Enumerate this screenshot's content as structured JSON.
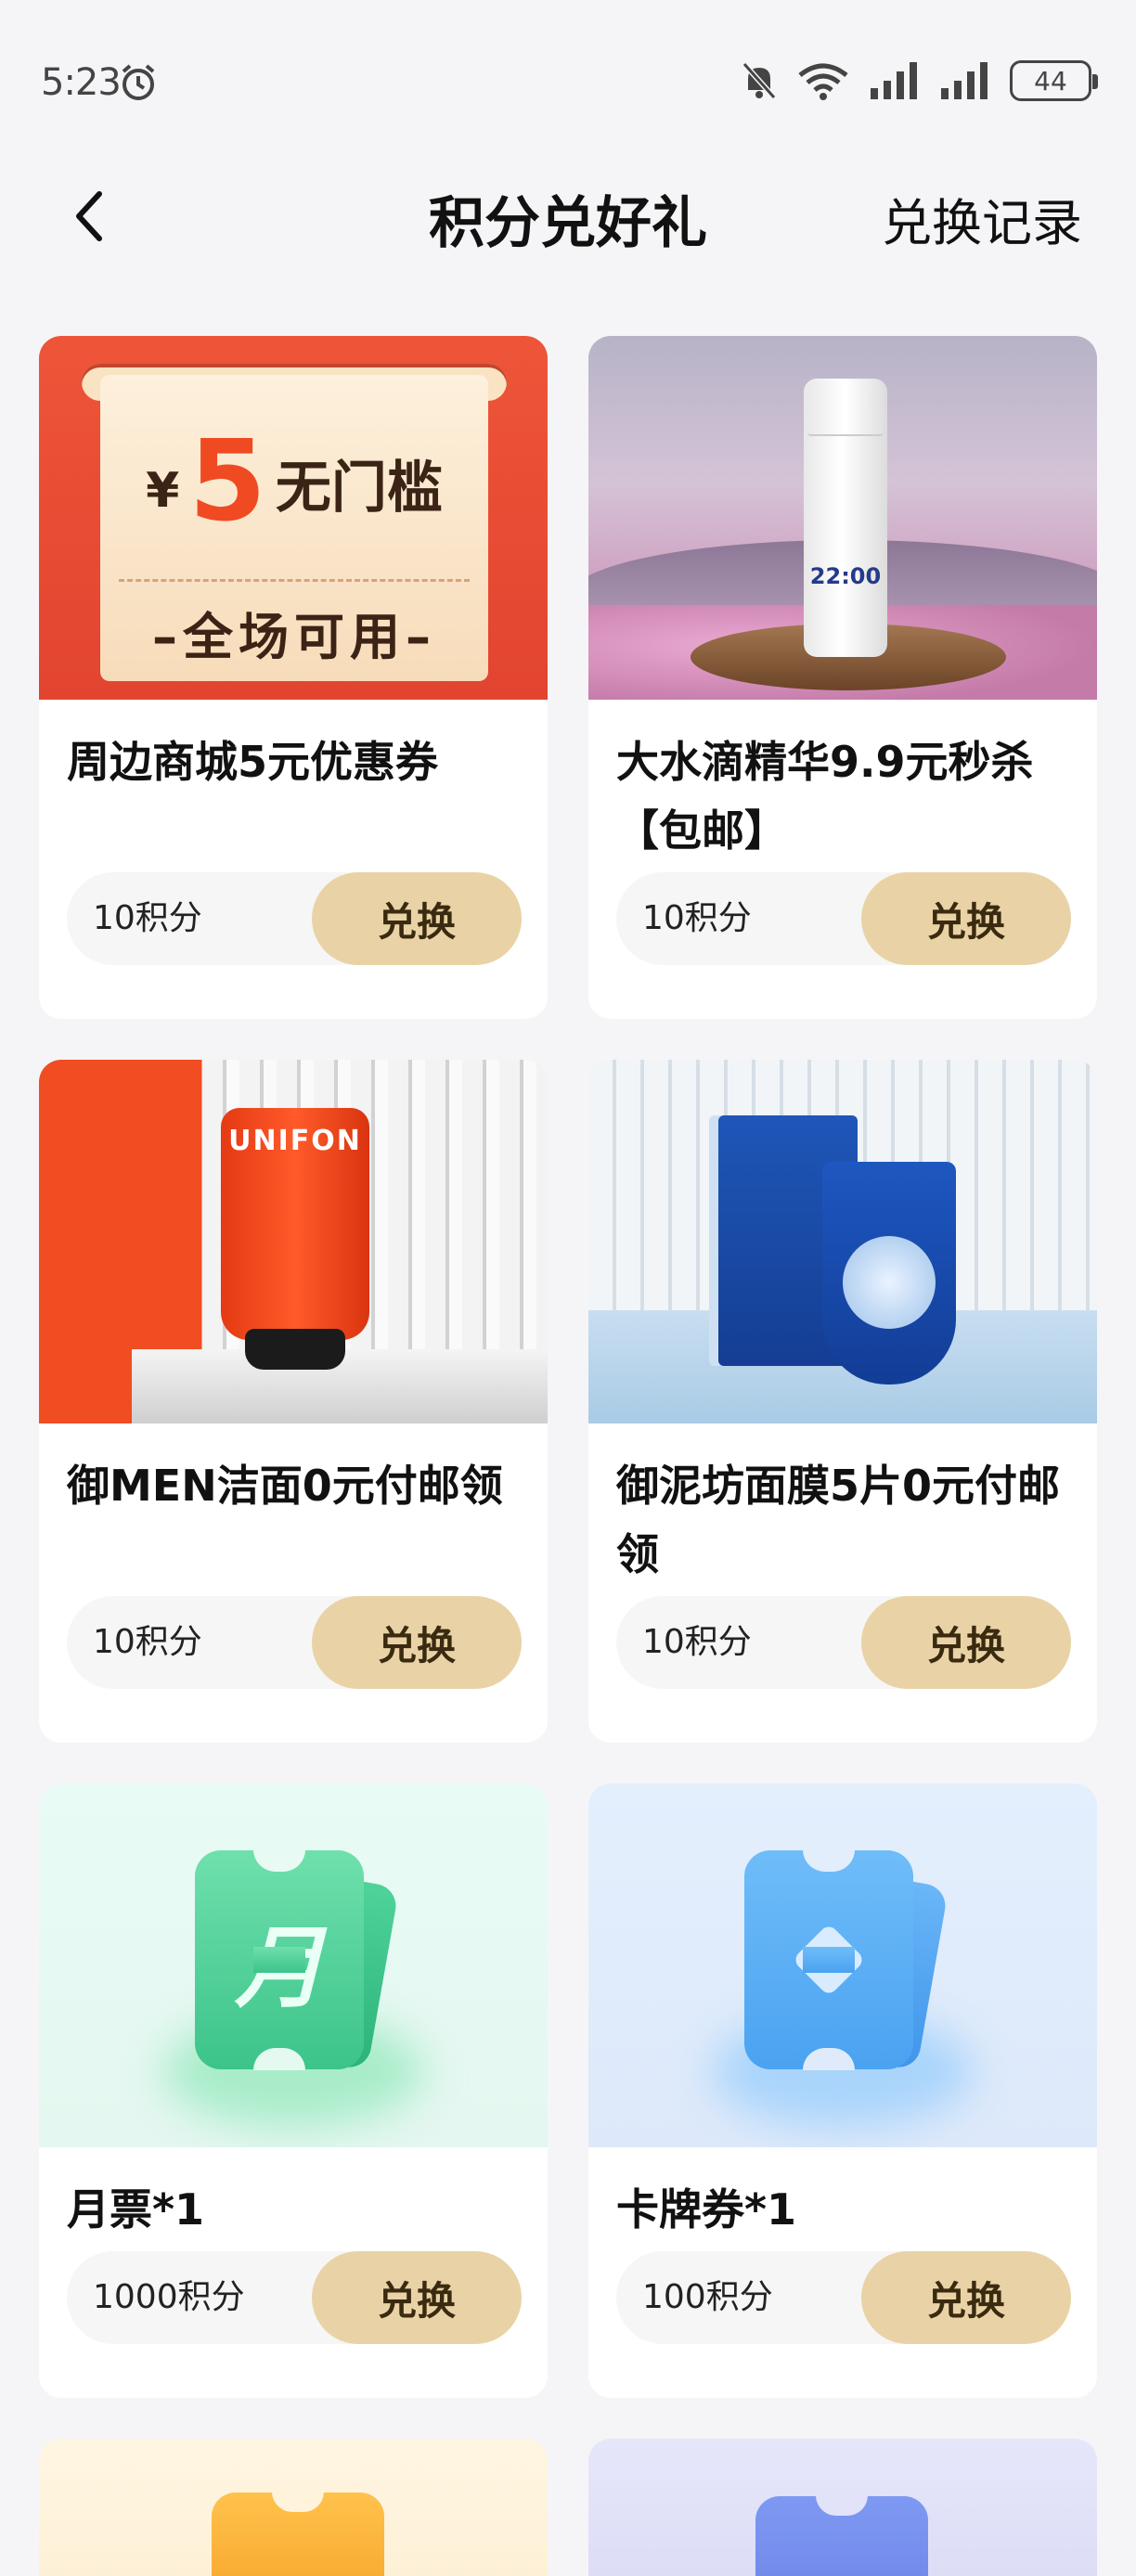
{
  "status_bar": {
    "time": "5:23",
    "battery": "44"
  },
  "header": {
    "title": "积分兑好礼",
    "record": "兑换记录"
  },
  "button_label": "兑换",
  "items": [
    {
      "title": "周边商城5元优惠券",
      "points": "10积分",
      "image": "coupon"
    },
    {
      "title": "大水滴精华9.9元秒杀【包邮】",
      "points": "10积分",
      "image": "serum"
    },
    {
      "title": "御MEN洁面0元付邮领",
      "points": "10积分",
      "image": "cleanser"
    },
    {
      "title": "御泥坊面膜5片0元付邮领",
      "points": "10积分",
      "image": "mask"
    },
    {
      "title": "月票*1",
      "points": "1000积分",
      "image": "green-ticket"
    },
    {
      "title": "卡牌券*1",
      "points": "100积分",
      "image": "blue-ticket"
    }
  ],
  "coupon_image": {
    "currency": "¥",
    "amount": "5",
    "label": "无门槛",
    "sub": "–全场可用–"
  },
  "serum_image": {
    "label": "22:00"
  },
  "cleanser_image": {
    "brand": "UNIFON"
  },
  "ticket_glyphs": {
    "monthly": "月"
  },
  "colors": {
    "redeem_button": "#e9d3a6",
    "background": "#f5f5f7",
    "coupon_red": "#ee5538"
  }
}
